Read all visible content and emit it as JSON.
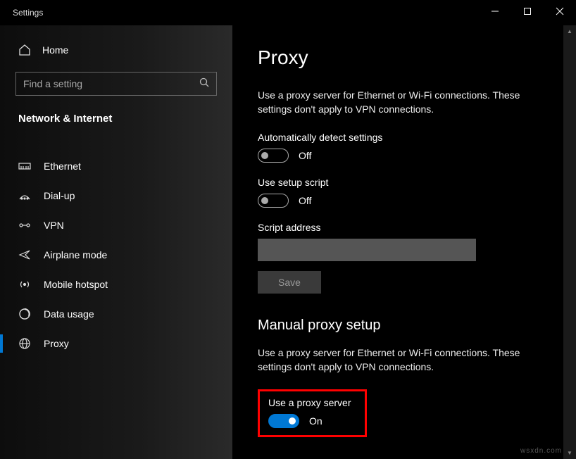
{
  "titlebar": {
    "title": "Settings"
  },
  "sidebar": {
    "home_label": "Home",
    "search_placeholder": "Find a setting",
    "category": "Network & Internet",
    "items": [
      {
        "label": "Ethernet"
      },
      {
        "label": "Dial-up"
      },
      {
        "label": "VPN"
      },
      {
        "label": "Airplane mode"
      },
      {
        "label": "Mobile hotspot"
      },
      {
        "label": "Data usage"
      },
      {
        "label": "Proxy"
      }
    ]
  },
  "content": {
    "page_title": "Proxy",
    "auto_desc": "Use a proxy server for Ethernet or Wi-Fi connections. These settings don't apply to VPN connections.",
    "auto_detect_label": "Automatically detect settings",
    "auto_detect_state": "Off",
    "use_script_label": "Use setup script",
    "use_script_state": "Off",
    "script_address_label": "Script address",
    "script_address_value": "",
    "save_button": "Save",
    "manual_heading": "Manual proxy setup",
    "manual_desc": "Use a proxy server for Ethernet or Wi-Fi connections. These settings don't apply to VPN connections.",
    "use_proxy_label": "Use a proxy server",
    "use_proxy_state": "On"
  },
  "watermark": "wsxdn.com"
}
